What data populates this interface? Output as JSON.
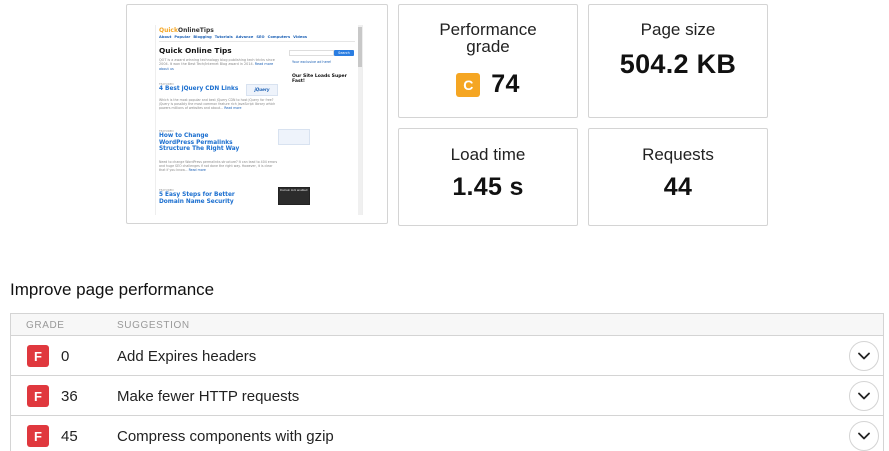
{
  "thumbnail": {
    "logo_prefix": "Quick",
    "logo_rest": "OnlineTips",
    "nav": [
      "About",
      "Popular",
      "Blogging",
      "Tutorials",
      "Advance",
      "SEO",
      "Computers",
      "Videos"
    ],
    "site_title": "Quick Online Tips",
    "search_button": "Search",
    "site_description": "QOT is a award winning technology blog publishing tech tricks since 2004. It won the Best Tech/Internet Blog award in 2014.",
    "site_description_more": "Read more about us",
    "ad_label": "Your exclusive ad here!",
    "sidebar_heading": "Our Site Loads Super Fast!",
    "featured_label": "FEATURED",
    "posts": [
      {
        "title": "4 Best jQuery CDN Links",
        "excerpt": "Which is the most popular and best jQuery CDN to host jQuery for free? jQuery is possibly the most common feature rich JavaScript library which powers millions of websites and about...",
        "more": "Read more"
      },
      {
        "title": "How to Change WordPress Permalinks Structure The Right Way",
        "excerpt": "Need to change WordPress permalinks structure? It can lead to 404 errors and huge SEO challenges if not done the right way. However, it is clear that if you know...",
        "more": "Read more"
      },
      {
        "title": "5 Easy Steps for Better Domain Name Security",
        "excerpt": "",
        "more": ""
      }
    ],
    "jquery_img_text": "jQuery",
    "dark_img_text": "Domain lock enabled"
  },
  "metrics": {
    "performance_grade_label": "Performance grade",
    "performance_grade_letter": "C",
    "performance_grade_value": "74",
    "page_size_label": "Page size",
    "page_size_value": "504.2 KB",
    "load_time_label": "Load time",
    "load_time_value": "1.45 s",
    "requests_label": "Requests",
    "requests_value": "44"
  },
  "improve": {
    "title": "Improve page performance",
    "col_grade": "GRADE",
    "col_suggestion": "SUGGESTION",
    "rows": [
      {
        "letter": "F",
        "score": "0",
        "suggestion": "Add Expires headers"
      },
      {
        "letter": "F",
        "score": "36",
        "suggestion": "Make fewer HTTP requests"
      },
      {
        "letter": "F",
        "score": "45",
        "suggestion": "Compress components with gzip"
      }
    ]
  },
  "colors": {
    "grade_c": "#f5a623",
    "grade_f": "#e0383e",
    "link_blue": "#1a6ecf"
  },
  "icons": {
    "expand": "chevron-down-icon"
  }
}
